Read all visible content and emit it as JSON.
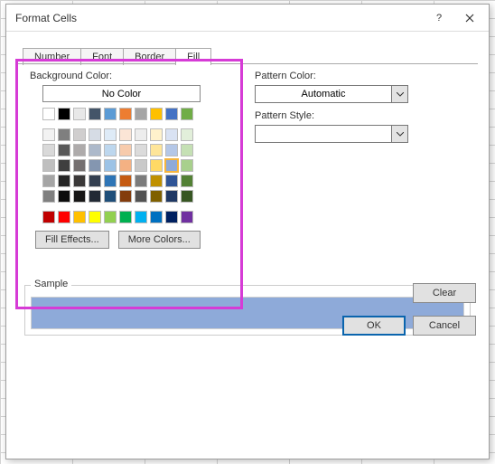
{
  "dialog": {
    "title": "Format Cells",
    "help_icon": "?",
    "close_icon": "×"
  },
  "tabs": {
    "items": [
      "Number",
      "Font",
      "Border",
      "Fill"
    ],
    "active_index": 3
  },
  "fill": {
    "bg_label": "Background Color:",
    "no_color": "No Color",
    "fill_effects": "Fill Effects...",
    "more_colors": "More Colors...",
    "pattern_color_label": "Pattern Color:",
    "pattern_color_value": "Automatic",
    "pattern_style_label": "Pattern Style:",
    "pattern_style_value": "",
    "selected_color": "#8eaad9",
    "basic_row": [
      "#ffffff",
      "#000000",
      "#e8e8e8",
      "#445569",
      "#5b9bd5",
      "#ed7d31",
      "#a5a5a5",
      "#ffc000",
      "#4472c4",
      "#70ad47"
    ],
    "theme_grid": [
      [
        "#f2f2f2",
        "#7f7f7f",
        "#d0cece",
        "#d6dce5",
        "#deebf7",
        "#fbe5d6",
        "#ededed",
        "#fff2cc",
        "#d9e2f3",
        "#e2efda"
      ],
      [
        "#d9d9d9",
        "#595959",
        "#aeabab",
        "#adb9ca",
        "#bdd7ee",
        "#f7cbac",
        "#dbdbdb",
        "#fee599",
        "#b4c7e7",
        "#c5e0b4"
      ],
      [
        "#bfbfbf",
        "#3f3f3f",
        "#757070",
        "#8496b0",
        "#9cc3e6",
        "#f4b183",
        "#c9c9c9",
        "#ffd965",
        "#8eaad9",
        "#a8d08d"
      ],
      [
        "#a5a5a5",
        "#262626",
        "#3a3838",
        "#333f50",
        "#2e75b6",
        "#c55a11",
        "#7b7b7b",
        "#bf9000",
        "#2f5496",
        "#538135"
      ],
      [
        "#7f7f7f",
        "#0c0c0c",
        "#171616",
        "#222a35",
        "#1e4e79",
        "#833c0c",
        "#525252",
        "#7f6000",
        "#1f3864",
        "#375623"
      ]
    ],
    "standard_row": [
      "#c00000",
      "#ff0000",
      "#ffc000",
      "#ffff00",
      "#92d050",
      "#00b050",
      "#00b0f0",
      "#0070c0",
      "#002060",
      "#7030a0"
    ]
  },
  "sample": {
    "label": "Sample",
    "color": "#8eaad9"
  },
  "buttons": {
    "clear": "Clear",
    "ok": "OK",
    "cancel": "Cancel"
  }
}
